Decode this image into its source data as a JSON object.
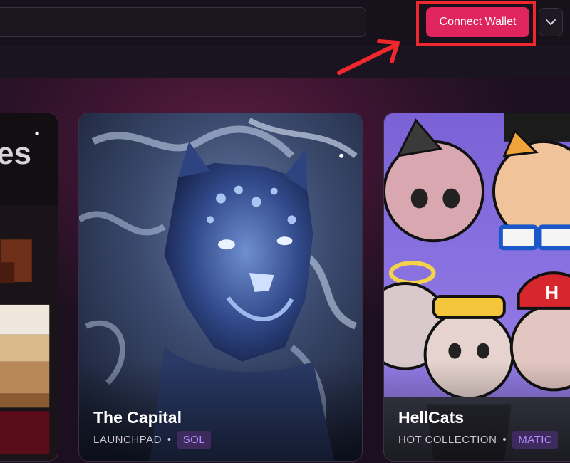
{
  "header": {
    "search_placeholder": "",
    "connect_label": "Connect Wallet",
    "dropdown_icon": "chevron-down-icon"
  },
  "annotation": {
    "color": "#f0282e",
    "arrow_icon": "arrow-icon"
  },
  "cards": [
    {
      "title": "",
      "partial_text": "es"
    },
    {
      "title": "The Capital",
      "category": "LAUNCHPAD",
      "chain": "SOL"
    },
    {
      "title": "HellCats",
      "category": "HOT COLLECTION",
      "chain": "MATIC"
    }
  ],
  "colors": {
    "accent": "#e0245e",
    "badge_bg": "#3e2b5e",
    "badge_text": "#b68cff"
  }
}
